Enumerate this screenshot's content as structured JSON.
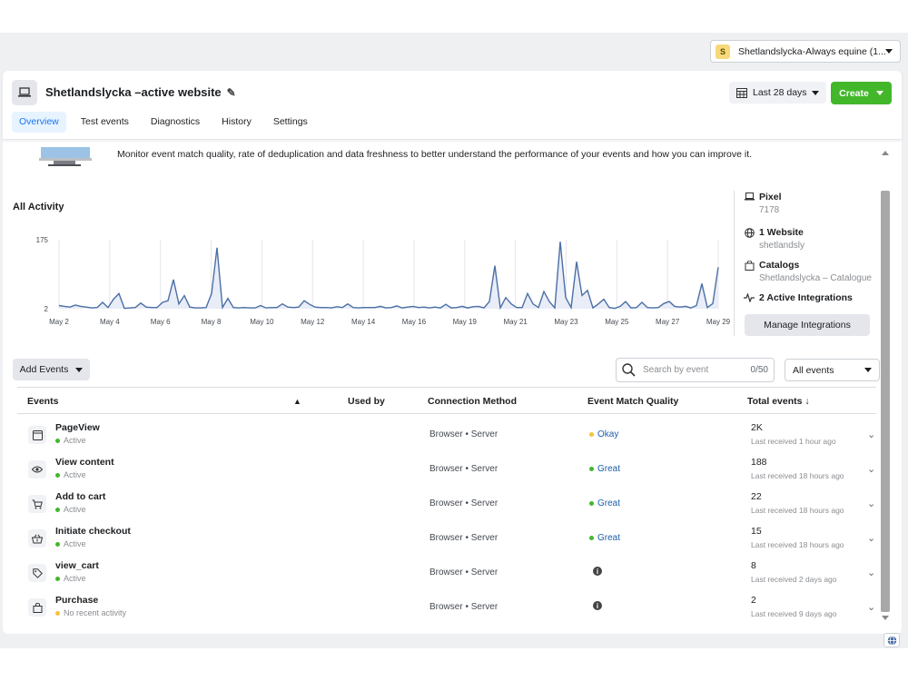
{
  "account": {
    "badge": "S",
    "name": "Shetlandslycka-Always equine (1..."
  },
  "header": {
    "title": "Shetlandslycka –active website",
    "date_range": "Last 28 days",
    "create_label": "Create",
    "tabs": [
      {
        "label": "Overview",
        "active": true
      },
      {
        "label": "Test events",
        "active": false
      },
      {
        "label": "Diagnostics",
        "active": false
      },
      {
        "label": "History",
        "active": false
      },
      {
        "label": "Settings",
        "active": false
      }
    ]
  },
  "banner": {
    "text": "Monitor event match quality, rate of deduplication and data freshness to better understand the performance of your events and how you can improve it."
  },
  "activity": {
    "title": "All Activity"
  },
  "chart_data": {
    "type": "line",
    "x_ticks": [
      "May 2",
      "May 4",
      "May 6",
      "May 8",
      "May 10",
      "May 12",
      "May 14",
      "May 16",
      "May 19",
      "May 21",
      "May 23",
      "May 25",
      "May 27",
      "May 29"
    ],
    "y_ticks": [
      "175",
      "2"
    ],
    "ylim": [
      2,
      175
    ],
    "color": "#4a6fa5",
    "fill": "#e9edf7",
    "values": [
      10,
      8,
      6,
      11,
      8,
      6,
      4,
      5,
      18,
      5,
      26,
      40,
      3,
      4,
      5,
      16,
      6,
      5,
      5,
      18,
      22,
      75,
      14,
      35,
      6,
      4,
      4,
      5,
      40,
      155,
      5,
      28,
      5,
      4,
      5,
      4,
      4,
      10,
      4,
      5,
      5,
      14,
      6,
      5,
      6,
      22,
      13,
      6,
      5,
      5,
      4,
      7,
      5,
      14,
      5,
      4,
      5,
      5,
      5,
      8,
      4,
      5,
      9,
      4,
      6,
      8,
      5,
      6,
      4,
      6,
      4,
      13,
      4,
      5,
      8,
      4,
      7,
      8,
      4,
      20,
      110,
      4,
      30,
      14,
      5,
      5,
      40,
      14,
      5,
      45,
      20,
      4,
      170,
      30,
      5,
      120,
      35,
      48,
      4,
      14,
      26,
      5,
      3,
      8,
      20,
      4,
      5,
      18,
      5,
      4,
      5,
      15,
      20,
      8,
      6,
      8,
      4,
      10,
      65,
      5,
      15,
      106
    ]
  },
  "sidebar": {
    "pixel_title": "Pixel",
    "pixel_id": "7178",
    "website_title": "1 Website",
    "website_domain": "shetlandsly",
    "catalogs_title": "Catalogs",
    "catalog_name": "Shetlandslycka – Catalogue",
    "integrations_title": "2 Active Integrations",
    "manage_label": "Manage Integrations"
  },
  "controls": {
    "add_events_label": "Add Events",
    "search_placeholder": "Search by event",
    "search_count": "0/50",
    "filter_label": "All events"
  },
  "table": {
    "columns": {
      "events": "Events",
      "warning": "▲",
      "used_by": "Used by",
      "connection": "Connection Method",
      "quality": "Event Match Quality",
      "total": "Total events ↓"
    },
    "rows": [
      {
        "name": "PageView",
        "status": "Active",
        "status_color": "#42b72a",
        "icon": "browser-window-icon",
        "connection": "Browser • Server",
        "quality": "Okay",
        "quality_color": "#f5c33b",
        "total": "2K",
        "last": "Last received 1 hour ago"
      },
      {
        "name": "View content",
        "status": "Active",
        "status_color": "#42b72a",
        "icon": "eye-icon",
        "connection": "Browser • Server",
        "quality": "Great",
        "quality_color": "#42b72a",
        "total": "188",
        "last": "Last received 18 hours ago"
      },
      {
        "name": "Add to cart",
        "status": "Active",
        "status_color": "#42b72a",
        "icon": "cart-icon",
        "connection": "Browser • Server",
        "quality": "Great",
        "quality_color": "#42b72a",
        "total": "22",
        "last": "Last received 18 hours ago"
      },
      {
        "name": "Initiate checkout",
        "status": "Active",
        "status_color": "#42b72a",
        "icon": "basket-icon",
        "connection": "Browser • Server",
        "quality": "Great",
        "quality_color": "#42b72a",
        "total": "15",
        "last": "Last received 18 hours ago"
      },
      {
        "name": "view_cart",
        "status": "Active",
        "status_color": "#42b72a",
        "icon": "tag-icon",
        "connection": "Browser • Server",
        "quality": "",
        "quality_color": "",
        "total": "8",
        "last": "Last received 2 days ago"
      },
      {
        "name": "Purchase",
        "status": "No recent activity",
        "status_color": "#f5c33b",
        "icon": "shopping-bag-icon",
        "connection": "Browser • Server",
        "quality": "",
        "quality_color": "",
        "total": "2",
        "last": "Last received 9 days ago"
      }
    ]
  }
}
